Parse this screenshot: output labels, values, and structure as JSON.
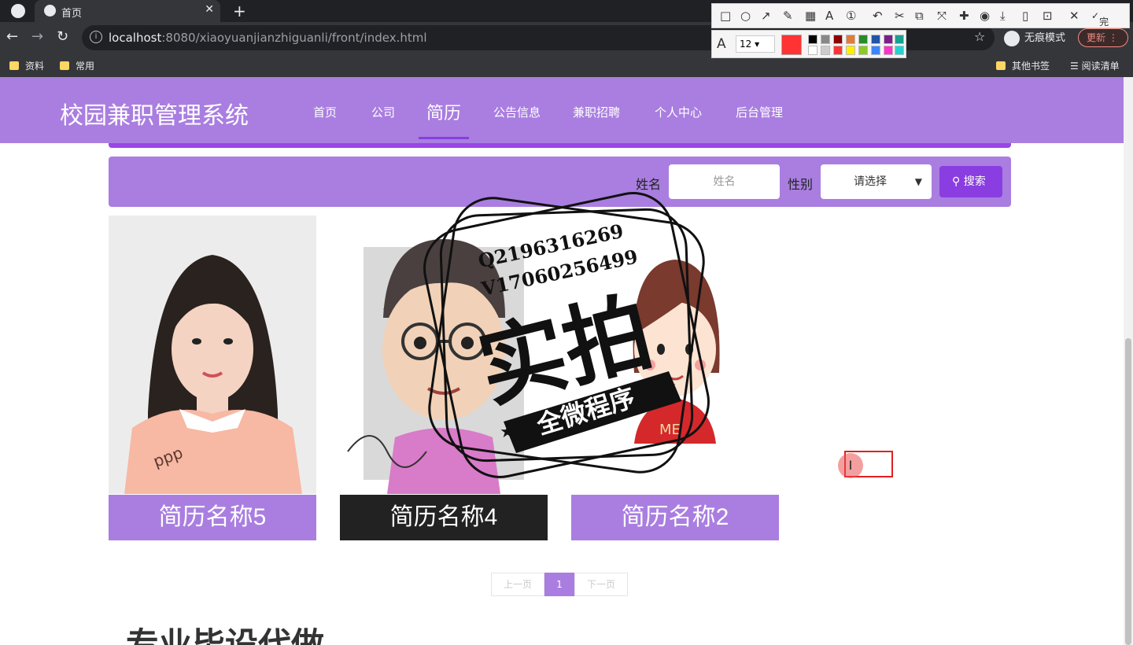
{
  "browser": {
    "tab_title": "首页",
    "url_host": "localhost",
    "url_path": ":8080/xiaoyuanjianzhiguanli/front/index.html",
    "incognito_label": "无痕模式",
    "update_label": "更新",
    "bookmarks": [
      "资料",
      "常用"
    ],
    "other_bookmarks": "其他书签",
    "reading_list": "阅读清单"
  },
  "snip_tool": {
    "done_label": "完成",
    "font_size": "12",
    "current_color": "#ff3333"
  },
  "site": {
    "title": "校园兼职管理系统",
    "nav": [
      {
        "label": "首页"
      },
      {
        "label": "公司"
      },
      {
        "label": "简历",
        "active": true
      },
      {
        "label": "公告信息"
      },
      {
        "label": "兼职招聘"
      },
      {
        "label": "个人中心"
      },
      {
        "label": "后台管理"
      }
    ],
    "brand_color": "#a97ee0",
    "accent_color": "#8a3de0"
  },
  "search": {
    "name_label": "姓名",
    "name_placeholder": "姓名",
    "gender_label": "性别",
    "gender_selected": "请选择",
    "button_label": "搜索"
  },
  "cards": [
    {
      "label": "简历名称5"
    },
    {
      "label": "简历名称4"
    },
    {
      "label": "简历名称2"
    }
  ],
  "watermark": {
    "line1": "Q2196316269",
    "line2": "V17060256499",
    "big": "实拍",
    "banner": "全微程序"
  },
  "pagination": {
    "prev": "上一页",
    "current": "1",
    "next": "下一页"
  },
  "footer": {
    "heading": "专业毕设代做"
  }
}
